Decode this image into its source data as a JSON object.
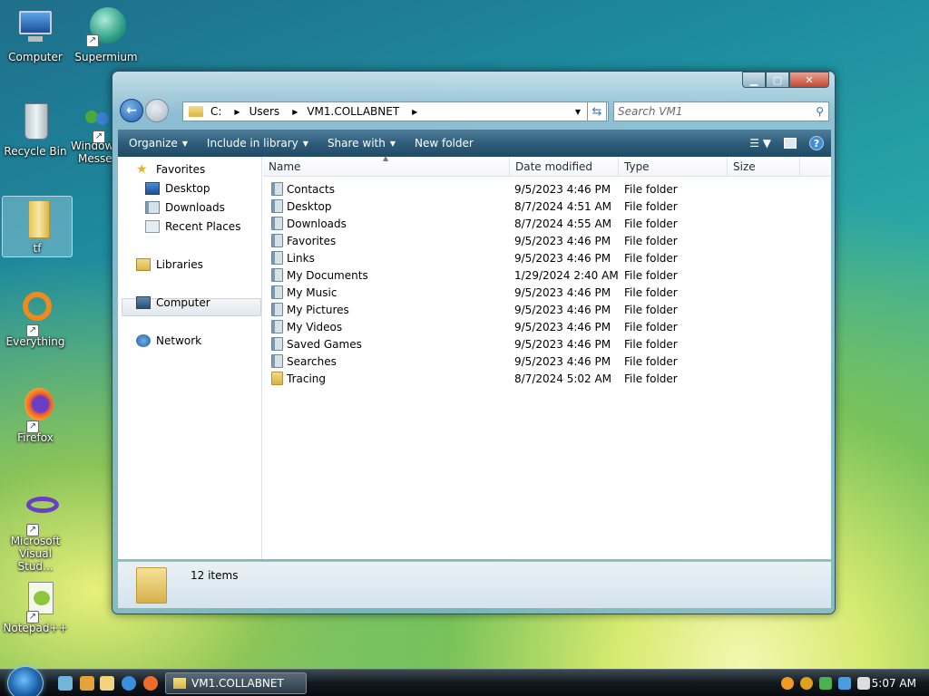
{
  "desktop": {
    "icons": [
      {
        "label": "Computer",
        "icon": "computer-icon"
      },
      {
        "label": "Supermium",
        "icon": "supermium-icon"
      },
      {
        "label": "Recycle Bin",
        "icon": "recycle-bin-icon"
      },
      {
        "label": "Windows Messenger",
        "label_line1": "Window",
        "label_line2": "Messe",
        "icon": "messenger-icon"
      },
      {
        "label": "tf",
        "icon": "folder-icon"
      },
      {
        "label": "Everything",
        "icon": "everything-icon"
      },
      {
        "label": "Firefox",
        "icon": "firefox-icon"
      },
      {
        "label_line1": "Microsoft",
        "label_line2": "Visual Stud...",
        "icon": "visual-studio-icon"
      },
      {
        "label": "Notepad++",
        "icon": "notepad-plus-plus-icon"
      }
    ]
  },
  "window": {
    "address": {
      "segments": [
        "C:",
        "Users",
        "VM1.COLLABNET"
      ]
    },
    "search_placeholder": "Search VM1",
    "toolbar": {
      "organize": "Organize",
      "include_in_library": "Include in library",
      "share_with": "Share with",
      "new_folder": "New folder"
    },
    "nav": {
      "favorites": "Favorites",
      "desktop": "Desktop",
      "downloads": "Downloads",
      "recent_places": "Recent Places",
      "libraries": "Libraries",
      "computer": "Computer",
      "network": "Network"
    },
    "columns": {
      "name": "Name",
      "date": "Date modified",
      "type": "Type",
      "size": "Size"
    },
    "files": [
      {
        "name": "Contacts",
        "date": "9/5/2023 4:46 PM",
        "type": "File folder"
      },
      {
        "name": "Desktop",
        "date": "8/7/2024 4:51 AM",
        "type": "File folder"
      },
      {
        "name": "Downloads",
        "date": "8/7/2024 4:55 AM",
        "type": "File folder"
      },
      {
        "name": "Favorites",
        "date": "9/5/2023 4:46 PM",
        "type": "File folder"
      },
      {
        "name": "Links",
        "date": "9/5/2023 4:46 PM",
        "type": "File folder"
      },
      {
        "name": "My Documents",
        "date": "1/29/2024 2:40 AM",
        "type": "File folder"
      },
      {
        "name": "My Music",
        "date": "9/5/2023 4:46 PM",
        "type": "File folder"
      },
      {
        "name": "My Pictures",
        "date": "9/5/2023 4:46 PM",
        "type": "File folder"
      },
      {
        "name": "My Videos",
        "date": "9/5/2023 4:46 PM",
        "type": "File folder"
      },
      {
        "name": "Saved Games",
        "date": "9/5/2023 4:46 PM",
        "type": "File folder"
      },
      {
        "name": "Searches",
        "date": "9/5/2023 4:46 PM",
        "type": "File folder"
      },
      {
        "name": "Tracing",
        "date": "8/7/2024 5:02 AM",
        "type": "File folder"
      }
    ],
    "status": "12 items"
  },
  "taskbar": {
    "window_button": "VM1.COLLABNET",
    "clock": "5:07 AM"
  },
  "colors": {
    "accent": "#2f5d7a",
    "selection": "#e2e8ee"
  }
}
